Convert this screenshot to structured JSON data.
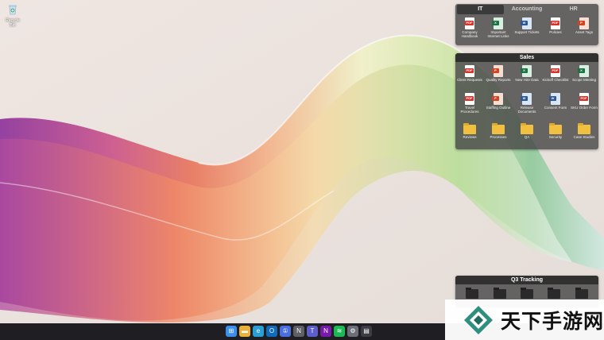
{
  "desktop": {
    "recycle_bin_label": "Recycle Bin"
  },
  "fence_top": {
    "tabs": [
      "IT",
      "Accounting",
      "HR"
    ],
    "active_tab": "IT",
    "items": [
      {
        "label": "Company Handbook",
        "icon": "pdf-icon",
        "type": "pdf",
        "badge": "PDF"
      },
      {
        "label": "Important Internet Links",
        "icon": "excel-icon",
        "type": "xls",
        "badge": "X"
      },
      {
        "label": "Support Tickets",
        "icon": "word-icon",
        "type": "doc",
        "badge": "W"
      },
      {
        "label": "Policies",
        "icon": "pdf-icon",
        "type": "pdf",
        "badge": "PDF"
      },
      {
        "label": "Asset Tags",
        "icon": "powerpoint-icon",
        "type": "ppt",
        "badge": "P"
      }
    ]
  },
  "fence_sales": {
    "title": "Sales",
    "items": [
      {
        "label": "Client Requests",
        "icon": "pdf-icon",
        "type": "pdf",
        "badge": "PDF"
      },
      {
        "label": "Quality Reports",
        "icon": "powerpoint-icon",
        "type": "ppt",
        "badge": "P"
      },
      {
        "label": "New Hire Data",
        "icon": "excel-icon",
        "type": "xls",
        "badge": "X"
      },
      {
        "label": "Kickoff Checklist",
        "icon": "pdf-icon",
        "type": "pdf",
        "badge": "PDF"
      },
      {
        "label": "Scope Meeting",
        "icon": "excel-icon",
        "type": "xls",
        "badge": "X"
      },
      {
        "label": "Travel Procedures",
        "icon": "pdf-icon",
        "type": "pdf",
        "badge": "PDF"
      },
      {
        "label": "Staffing Outline",
        "icon": "powerpoint-icon",
        "type": "ppt",
        "badge": "P"
      },
      {
        "label": "Release Documents",
        "icon": "word-icon",
        "type": "doc",
        "badge": "W"
      },
      {
        "label": "Consent Form",
        "icon": "word-icon",
        "type": "doc",
        "badge": "W"
      },
      {
        "label": "SKU Order Form",
        "icon": "pdf-icon",
        "type": "pdf",
        "badge": "PDF"
      }
    ],
    "folders": [
      "Reviews",
      "Processes",
      "QA",
      "Security",
      "Case Studies"
    ]
  },
  "fence_q3": {
    "title": "Q3 Tracking"
  },
  "taskbar": {
    "icons": [
      {
        "name": "start-icon",
        "color": "#3b8eea",
        "glyph": "⊞"
      },
      {
        "name": "file-explorer-icon",
        "color": "#e8b13a",
        "glyph": "▬"
      },
      {
        "name": "edge-icon",
        "color": "#2a9fd6",
        "glyph": "e"
      },
      {
        "name": "outlook-icon",
        "color": "#0f6cbd",
        "glyph": "O"
      },
      {
        "name": "onepassword-icon",
        "color": "#4a6ee0",
        "glyph": "①"
      },
      {
        "name": "notion-icon",
        "color": "#5f5f66",
        "glyph": "N"
      },
      {
        "name": "teams-icon",
        "color": "#5b5fc7",
        "glyph": "T"
      },
      {
        "name": "onenote-icon",
        "color": "#7719aa",
        "glyph": "N"
      },
      {
        "name": "spotify-icon",
        "color": "#1db954",
        "glyph": "≋"
      },
      {
        "name": "settings-icon",
        "color": "#6b6f78",
        "glyph": "⚙"
      },
      {
        "name": "fences-icon",
        "color": "#3c3c44",
        "glyph": "▤"
      }
    ]
  },
  "watermark": {
    "text": "天下手游网"
  }
}
